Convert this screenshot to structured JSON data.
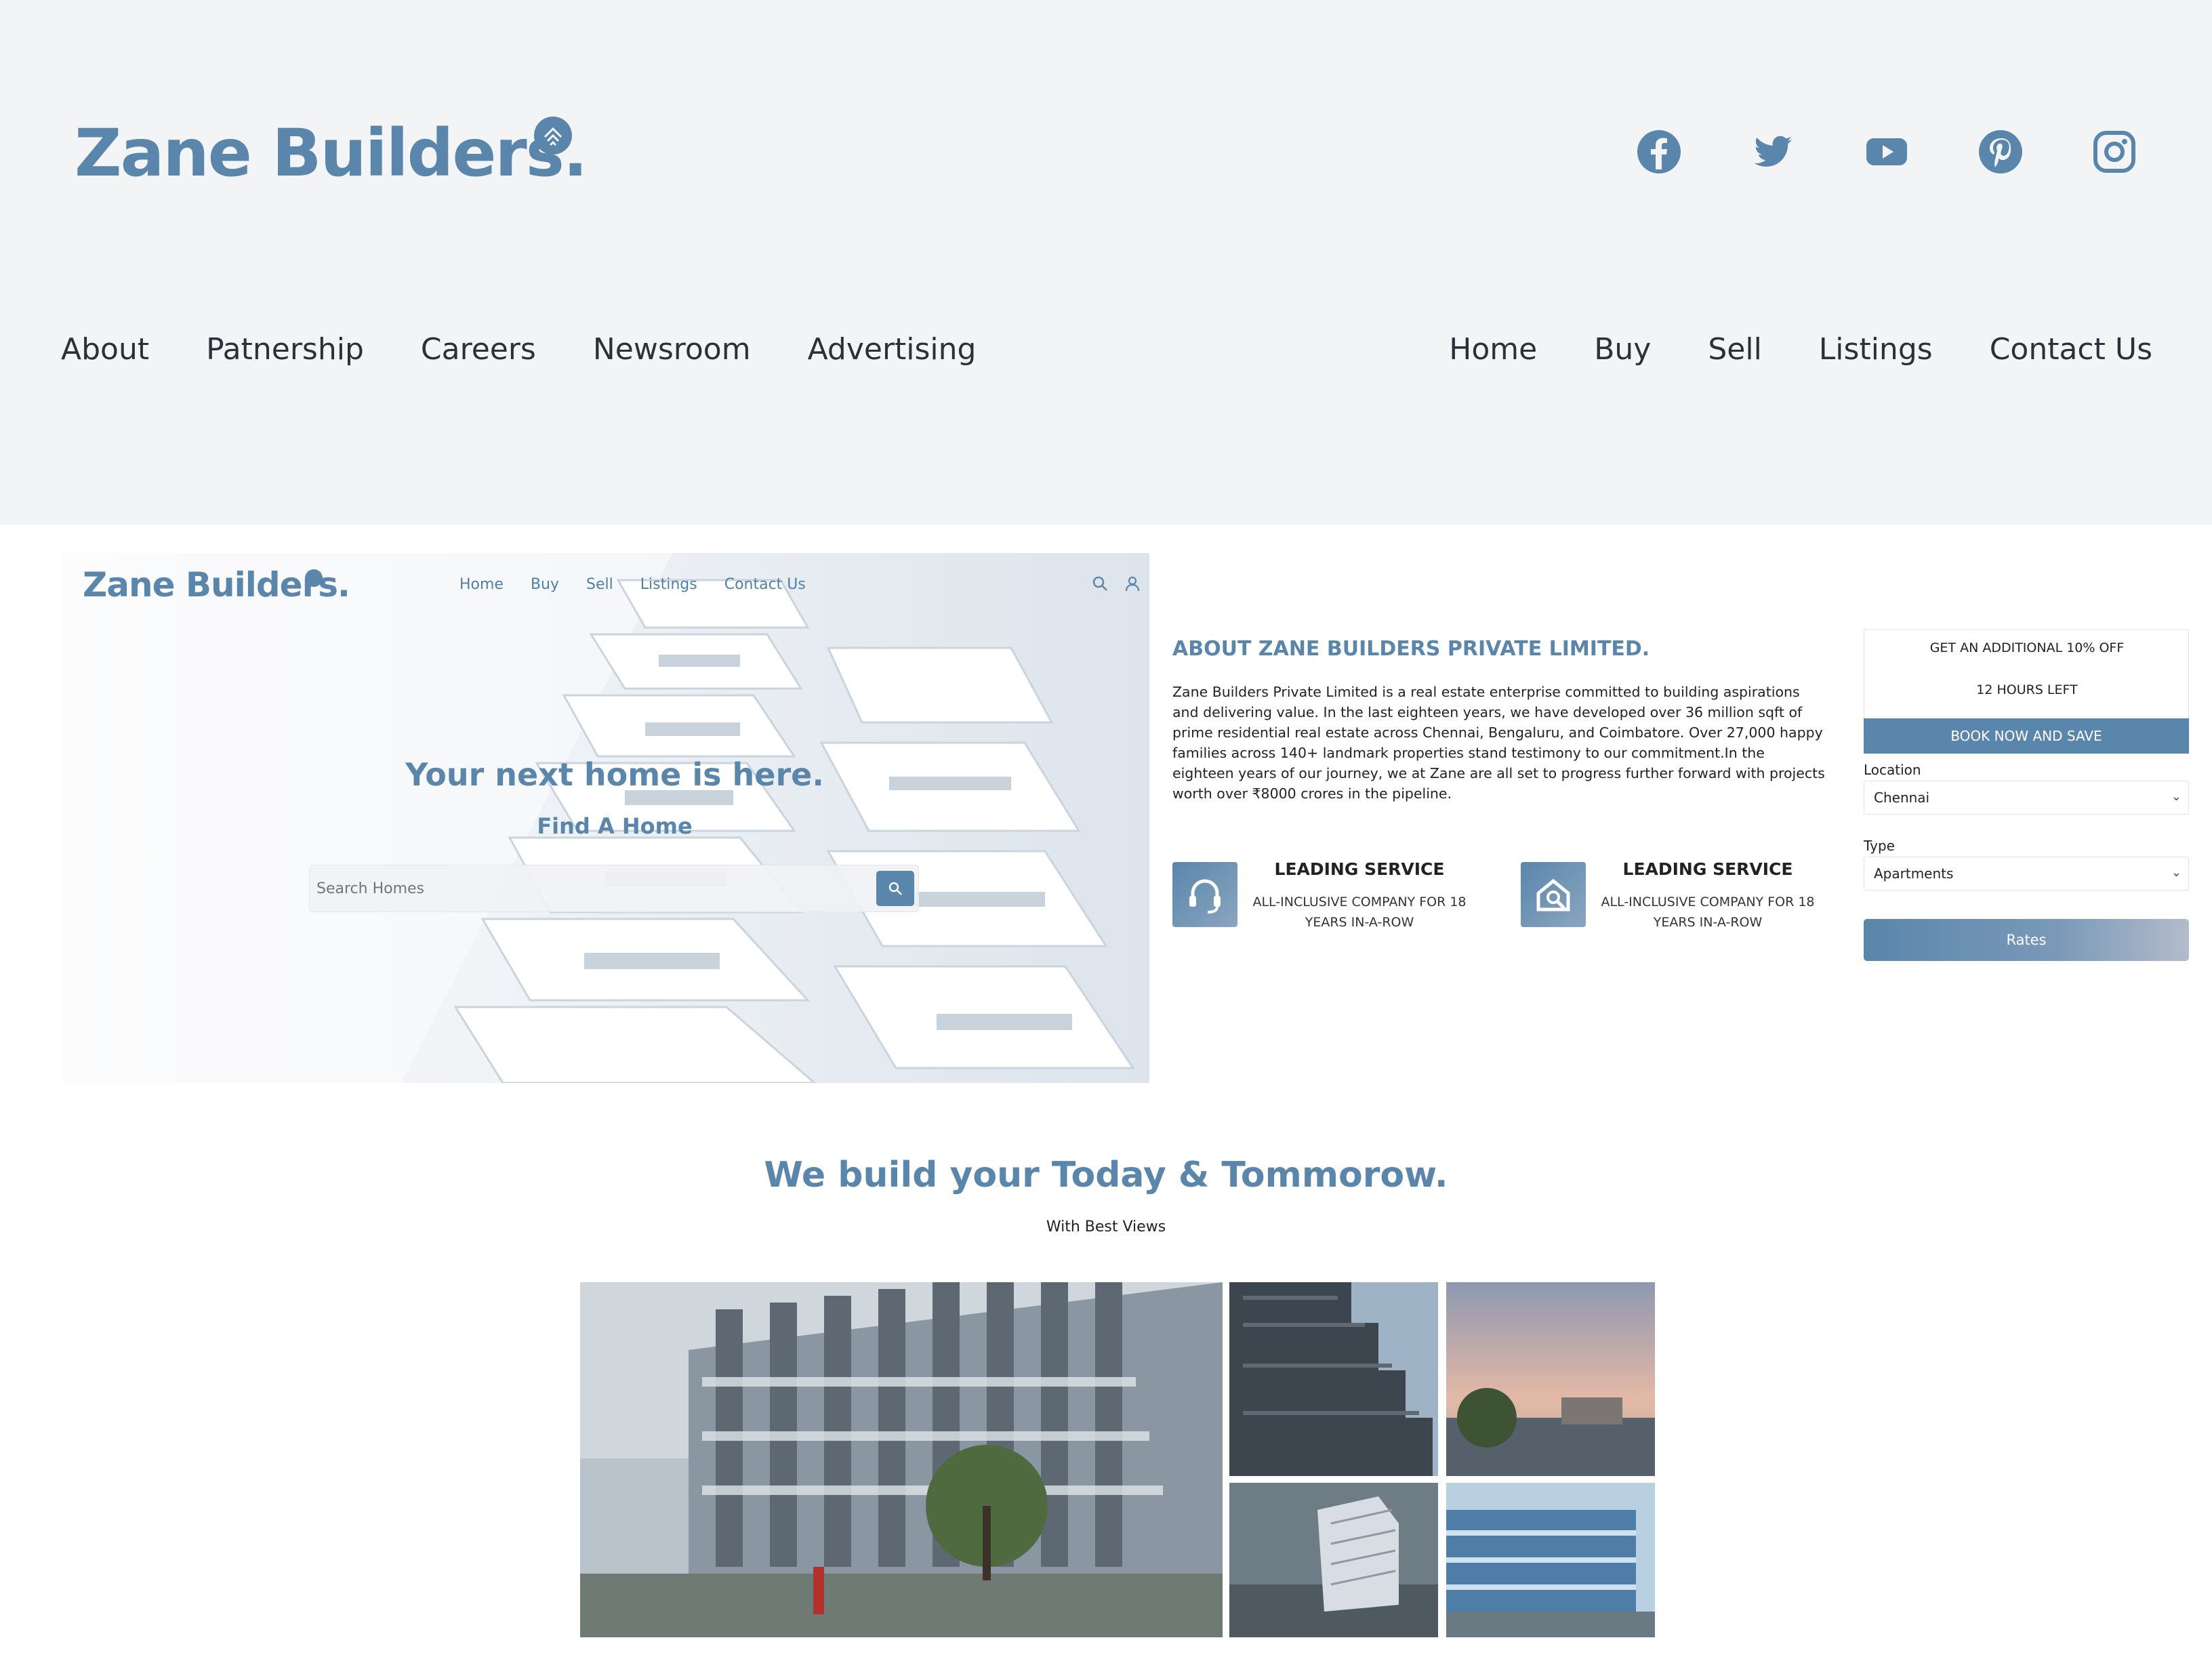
{
  "header": {
    "brand": "Zane Builders.",
    "social": [
      "facebook-icon",
      "twitter-icon",
      "youtube-icon",
      "pinterest-icon",
      "instagram-icon"
    ],
    "nav_left": [
      "About",
      "Patnership",
      "Careers",
      "Newsroom",
      "Advertising"
    ],
    "nav_right": [
      "Home",
      "Buy",
      "Sell",
      "Listings",
      "Contact Us"
    ]
  },
  "hero": {
    "brand": "Zane Builders.",
    "nav": [
      "Home",
      "Buy",
      "Sell",
      "Listings",
      "Contact Us"
    ],
    "title": "Your next home is here.",
    "subtitle": "Find A Home",
    "search_placeholder": "Search Homes"
  },
  "about": {
    "title": "ABOUT ZANE BUILDERS PRIVATE LIMITED.",
    "text": "Zane Builders Private Limited is a real estate enterprise committed to building aspirations and delivering value. In the last eighteen years, we have developed over 36 million sqft of prime residential real estate across Chennai, Bengaluru, and Coimbatore. Over 27,000 happy families across 140+ landmark properties stand testimony to our commitment.In the eighteen years of our journey, we at Zane are all set to progress further forward with projects worth over ₹8000 crores in the pipeline.",
    "features": [
      {
        "title": "LEADING SERVICE",
        "desc": "ALL-INCLUSIVE COMPANY FOR 18 YEARS IN-A-ROW",
        "icon": "headset-icon"
      },
      {
        "title": "LEADING SERVICE",
        "desc": "ALL-INCLUSIVE COMPANY FOR 18 YEARS IN-A-ROW",
        "icon": "search-house-icon"
      }
    ]
  },
  "booking": {
    "offer": "GET AN ADDITIONAL 10% OFF",
    "time_left": "12 HOURS LEFT",
    "book_label": "BOOK NOW AND SAVE",
    "location_label": "Location",
    "location_value": "Chennai",
    "type_label": "Type",
    "type_value": "Apartments",
    "rates_label": "Rates"
  },
  "gallery": {
    "title": "We build your Today & Tommorow.",
    "subtitle": "With Best Views"
  },
  "colors": {
    "accent": "#5a86ab",
    "header_bg": "#f3f4f6"
  }
}
